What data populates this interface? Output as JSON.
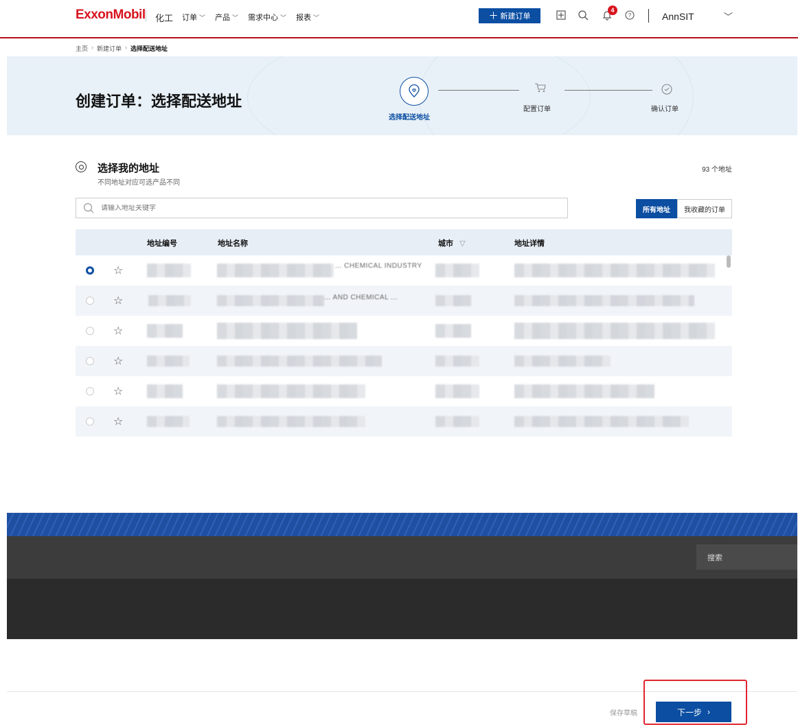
{
  "header": {
    "logo": "ExxonMobil",
    "sub_brand": "化工",
    "nav": [
      {
        "label": "订单"
      },
      {
        "label": "产品"
      },
      {
        "label": "需求中心"
      },
      {
        "label": "报表"
      }
    ],
    "new_order_label": "新建订单",
    "new_order_icon": "plus-icon",
    "notification_count": "4",
    "user_name": "AnnSIT"
  },
  "breadcrumb": [
    "主页",
    "新建订单",
    "选择配送地址"
  ],
  "banner": {
    "title": "创建订单：选择配送地址",
    "steps": [
      {
        "label": "选择配送地址",
        "icon": "location-heart-icon",
        "active": true
      },
      {
        "label": "配置订单",
        "icon": "cart-icon",
        "active": false
      },
      {
        "label": "确认订单",
        "icon": "check-circle-icon",
        "active": false
      }
    ]
  },
  "address_section": {
    "title": "选择我的地址",
    "subtitle": "不同地址对应可选产品不同",
    "count_label": "93 个地址",
    "search_placeholder": "请输入地址关键字",
    "tabs": [
      {
        "label": "所有地址",
        "active": true
      },
      {
        "label": "我收藏的订单",
        "active": false
      }
    ]
  },
  "table": {
    "columns": [
      "地址编号",
      "地址名称",
      "城市",
      "地址详情"
    ],
    "rows": [
      {
        "selected": true,
        "partial_name": "... CHEMICAL INDUSTRY"
      },
      {
        "selected": false,
        "partial_name": "... AND CHEMICAL ..."
      },
      {
        "selected": false,
        "partial_name": ""
      },
      {
        "selected": false,
        "partial_name": ""
      },
      {
        "selected": false,
        "partial_name": ""
      },
      {
        "selected": false,
        "partial_name": ""
      }
    ]
  },
  "footer": {
    "search_label": "搜索"
  },
  "actions": {
    "save_draft_label": "保存草稿",
    "next_label": "下一步"
  },
  "colors": {
    "brand_red": "#d8141f",
    "primary_blue": "#0b4ea2",
    "banner_bg": "#e8f1f8",
    "highlight_red": "#e0252f"
  }
}
